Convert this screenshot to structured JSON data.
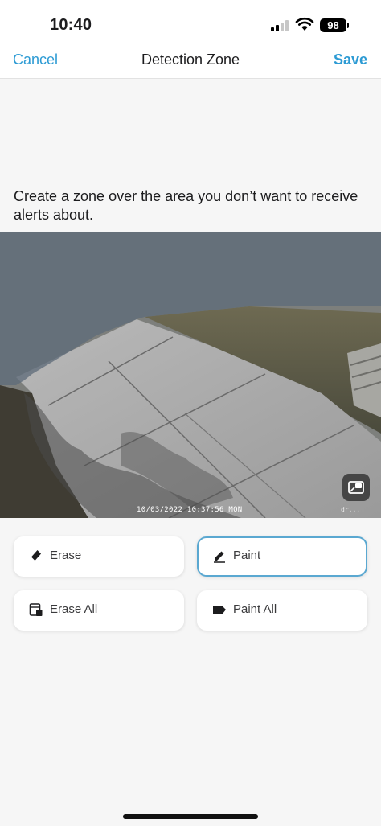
{
  "status_bar": {
    "time": "10:40",
    "battery_level": "98",
    "signal_bars_active": 2,
    "signal_bars_total": 4,
    "wifi_icon": "wifi-icon"
  },
  "nav": {
    "cancel_label": "Cancel",
    "title": "Detection Zone",
    "save_label": "Save",
    "accent_color": "#2d9bd4"
  },
  "instruction": "Create a zone over the area you don’t want to receive alerts about.",
  "camera": {
    "timestamp": "10/03/2022 10:37:56 MON",
    "watermark": "dr...",
    "zone_overlay_color": "#5f6b7a",
    "pip_icon": "picture-in-picture-icon"
  },
  "tools": {
    "erase": {
      "label": "Erase",
      "icon": "eraser-icon"
    },
    "paint": {
      "label": "Paint",
      "icon": "pencil-icon",
      "selected": true
    },
    "erase_all": {
      "label": "Erase All",
      "icon": "trash-icon"
    },
    "paint_all": {
      "label": "Paint All",
      "icon": "paint-roller-icon"
    },
    "selected_border_color": "#5aa8d1"
  }
}
